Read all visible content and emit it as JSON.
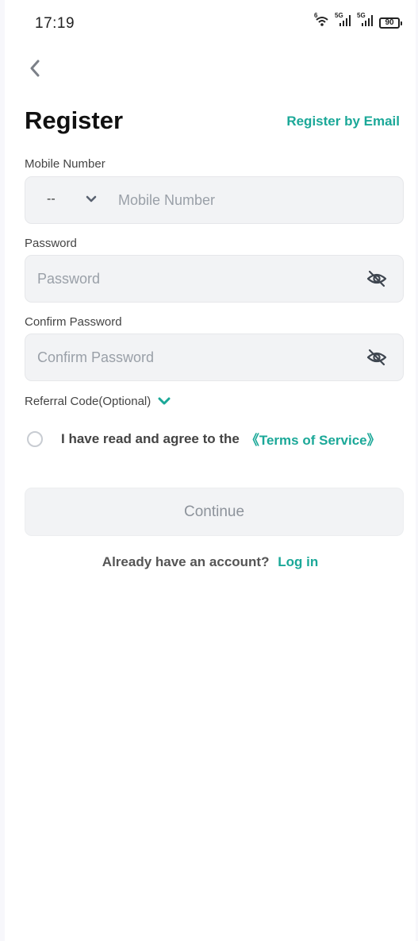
{
  "status_bar": {
    "time": "17:19",
    "wifi_badge": "6",
    "sim1_label": "5G",
    "sim2_label": "5G",
    "battery": "90",
    "icons": [
      "wifi-icon",
      "signal-icon",
      "signal-icon",
      "battery-icon"
    ]
  },
  "header": {
    "back_icon": "chevron-left-icon",
    "title": "Register",
    "email_link": "Register by Email"
  },
  "form": {
    "mobile": {
      "label": "Mobile Number",
      "country_code": "--",
      "placeholder": "Mobile Number",
      "value": ""
    },
    "password": {
      "label": "Password",
      "placeholder": "Password",
      "value": "",
      "toggle_icon": "eye-off-icon"
    },
    "confirm_password": {
      "label": "Confirm Password",
      "placeholder": "Confirm Password",
      "value": "",
      "toggle_icon": "eye-off-icon"
    },
    "referral": {
      "label": "Referral Code(Optional)",
      "icon": "chevron-down-icon"
    },
    "agreement": {
      "text": "I have read and agree to the",
      "terms_link": "《Terms of Service》",
      "checked": false
    }
  },
  "actions": {
    "continue_label": "Continue",
    "login_prompt": "Already have an account?",
    "login_link": "Log in"
  },
  "colors": {
    "accent": "#1ba898",
    "field_bg": "#f2f3f5",
    "text_dark": "#111111",
    "text_muted": "#9aa0a8"
  }
}
